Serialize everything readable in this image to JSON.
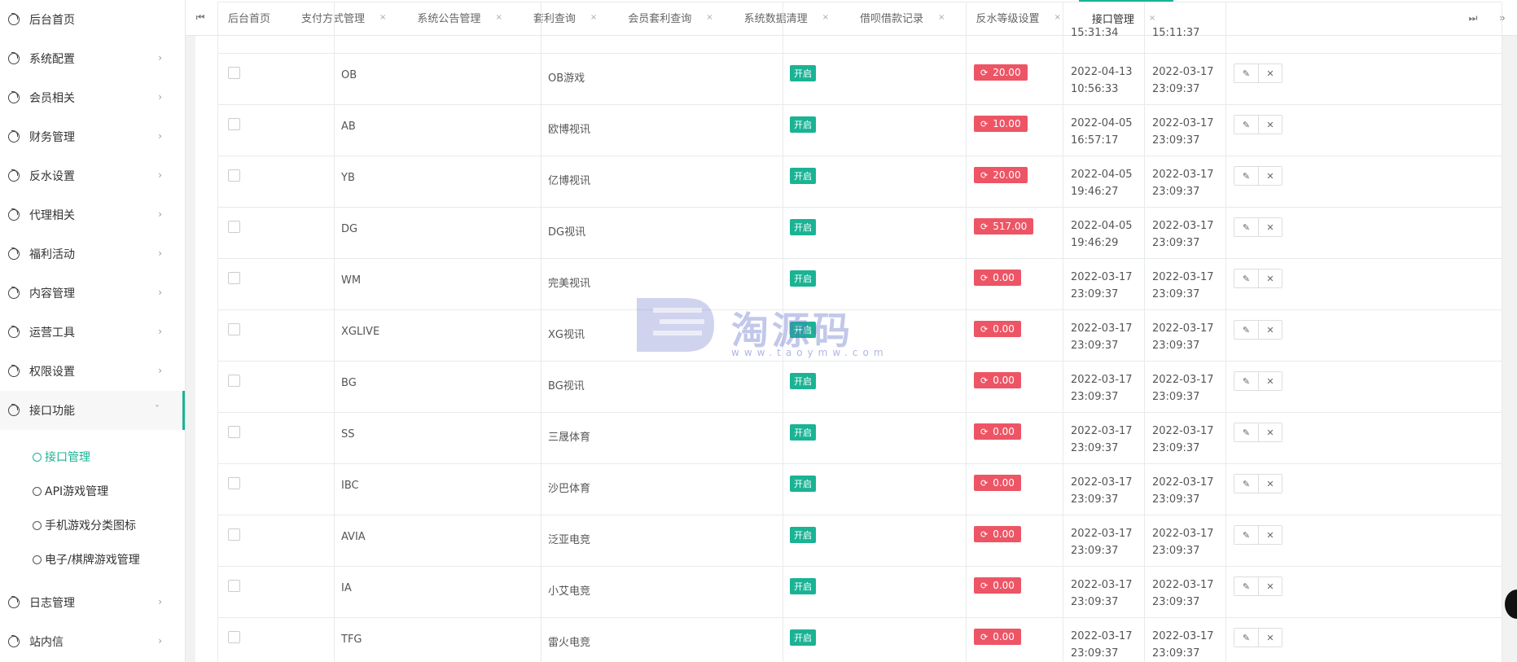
{
  "sidebar": {
    "items": [
      {
        "label": "后台首页",
        "arrow": ""
      },
      {
        "label": "系统配置",
        "arrow": "›"
      },
      {
        "label": "会员相关",
        "arrow": "›"
      },
      {
        "label": "财务管理",
        "arrow": "›"
      },
      {
        "label": "反水设置",
        "arrow": "›"
      },
      {
        "label": "代理相关",
        "arrow": "›"
      },
      {
        "label": "福利活动",
        "arrow": "›"
      },
      {
        "label": "内容管理",
        "arrow": "›"
      },
      {
        "label": "运营工具",
        "arrow": "›"
      },
      {
        "label": "权限设置",
        "arrow": "›"
      },
      {
        "label": "接口功能",
        "arrow": "ˇ"
      }
    ],
    "submenu": [
      {
        "label": "接口管理"
      },
      {
        "label": "API游戏管理"
      },
      {
        "label": "手机游戏分类图标"
      },
      {
        "label": "电子/棋牌游戏管理"
      }
    ],
    "bottom_items": [
      {
        "label": "日志管理",
        "arrow": "›"
      },
      {
        "label": "站内信",
        "arrow": "›"
      }
    ]
  },
  "tabs": {
    "first_nav": "⏮",
    "items": [
      {
        "label": "后台首页",
        "close": ""
      },
      {
        "label": "支付方式管理",
        "close": "×"
      },
      {
        "label": "系统公告管理",
        "close": "×"
      },
      {
        "label": "套利查询",
        "close": "×"
      },
      {
        "label": "会员套利查询",
        "close": "×"
      },
      {
        "label": "系统数据清理",
        "close": "×"
      },
      {
        "label": "借呗借款记录",
        "close": "×"
      },
      {
        "label": "反水等级设置",
        "close": "×"
      },
      {
        "label": "接口管理",
        "close": "×"
      }
    ],
    "last_nav": "⏭",
    "more": "»"
  },
  "table": {
    "status_label": "开启",
    "refresh_icon": "⟳",
    "edit_icon": "✎",
    "delete_icon": "✕",
    "top_row": {
      "date1": "15:31:34",
      "date2": "15:11:37"
    },
    "rows": [
      {
        "code": "OB",
        "name": "OB游戏",
        "balance": "20.00",
        "d1a": "2022-04-13",
        "d1b": "10:56:33",
        "d2a": "2022-03-17",
        "d2b": "23:09:37"
      },
      {
        "code": "AB",
        "name": "欧博视讯",
        "balance": "10.00",
        "d1a": "2022-04-05",
        "d1b": "16:57:17",
        "d2a": "2022-03-17",
        "d2b": "23:09:37"
      },
      {
        "code": "YB",
        "name": "亿博视讯",
        "balance": "20.00",
        "d1a": "2022-04-05",
        "d1b": "19:46:27",
        "d2a": "2022-03-17",
        "d2b": "23:09:37"
      },
      {
        "code": "DG",
        "name": "DG视讯",
        "balance": "517.00",
        "d1a": "2022-04-05",
        "d1b": "19:46:29",
        "d2a": "2022-03-17",
        "d2b": "23:09:37"
      },
      {
        "code": "WM",
        "name": "完美视讯",
        "balance": "0.00",
        "d1a": "2022-03-17",
        "d1b": "23:09:37",
        "d2a": "2022-03-17",
        "d2b": "23:09:37"
      },
      {
        "code": "XGLIVE",
        "name": "XG视讯",
        "balance": "0.00",
        "d1a": "2022-03-17",
        "d1b": "23:09:37",
        "d2a": "2022-03-17",
        "d2b": "23:09:37"
      },
      {
        "code": "BG",
        "name": "BG视讯",
        "balance": "0.00",
        "d1a": "2022-03-17",
        "d1b": "23:09:37",
        "d2a": "2022-03-17",
        "d2b": "23:09:37"
      },
      {
        "code": "SS",
        "name": "三晟体育",
        "balance": "0.00",
        "d1a": "2022-03-17",
        "d1b": "23:09:37",
        "d2a": "2022-03-17",
        "d2b": "23:09:37"
      },
      {
        "code": "IBC",
        "name": "沙巴体育",
        "balance": "0.00",
        "d1a": "2022-03-17",
        "d1b": "23:09:37",
        "d2a": "2022-03-17",
        "d2b": "23:09:37"
      },
      {
        "code": "AVIA",
        "name": "泛亚电竞",
        "balance": "0.00",
        "d1a": "2022-03-17",
        "d1b": "23:09:37",
        "d2a": "2022-03-17",
        "d2b": "23:09:37"
      },
      {
        "code": "IA",
        "name": "小艾电竞",
        "balance": "0.00",
        "d1a": "2022-03-17",
        "d1b": "23:09:37",
        "d2a": "2022-03-17",
        "d2b": "23:09:37"
      },
      {
        "code": "TFG",
        "name": "雷火电竞",
        "balance": "0.00",
        "d1a": "2022-03-17",
        "d1b": "23:09:37",
        "d2a": "2022-03-17",
        "d2b": "23:09:37"
      }
    ]
  },
  "watermark": {
    "text": "淘源码",
    "url": "www.taoymw.com"
  },
  "colors": {
    "accent": "#1ab394",
    "danger": "#ed5565",
    "border": "#e7eaec"
  }
}
